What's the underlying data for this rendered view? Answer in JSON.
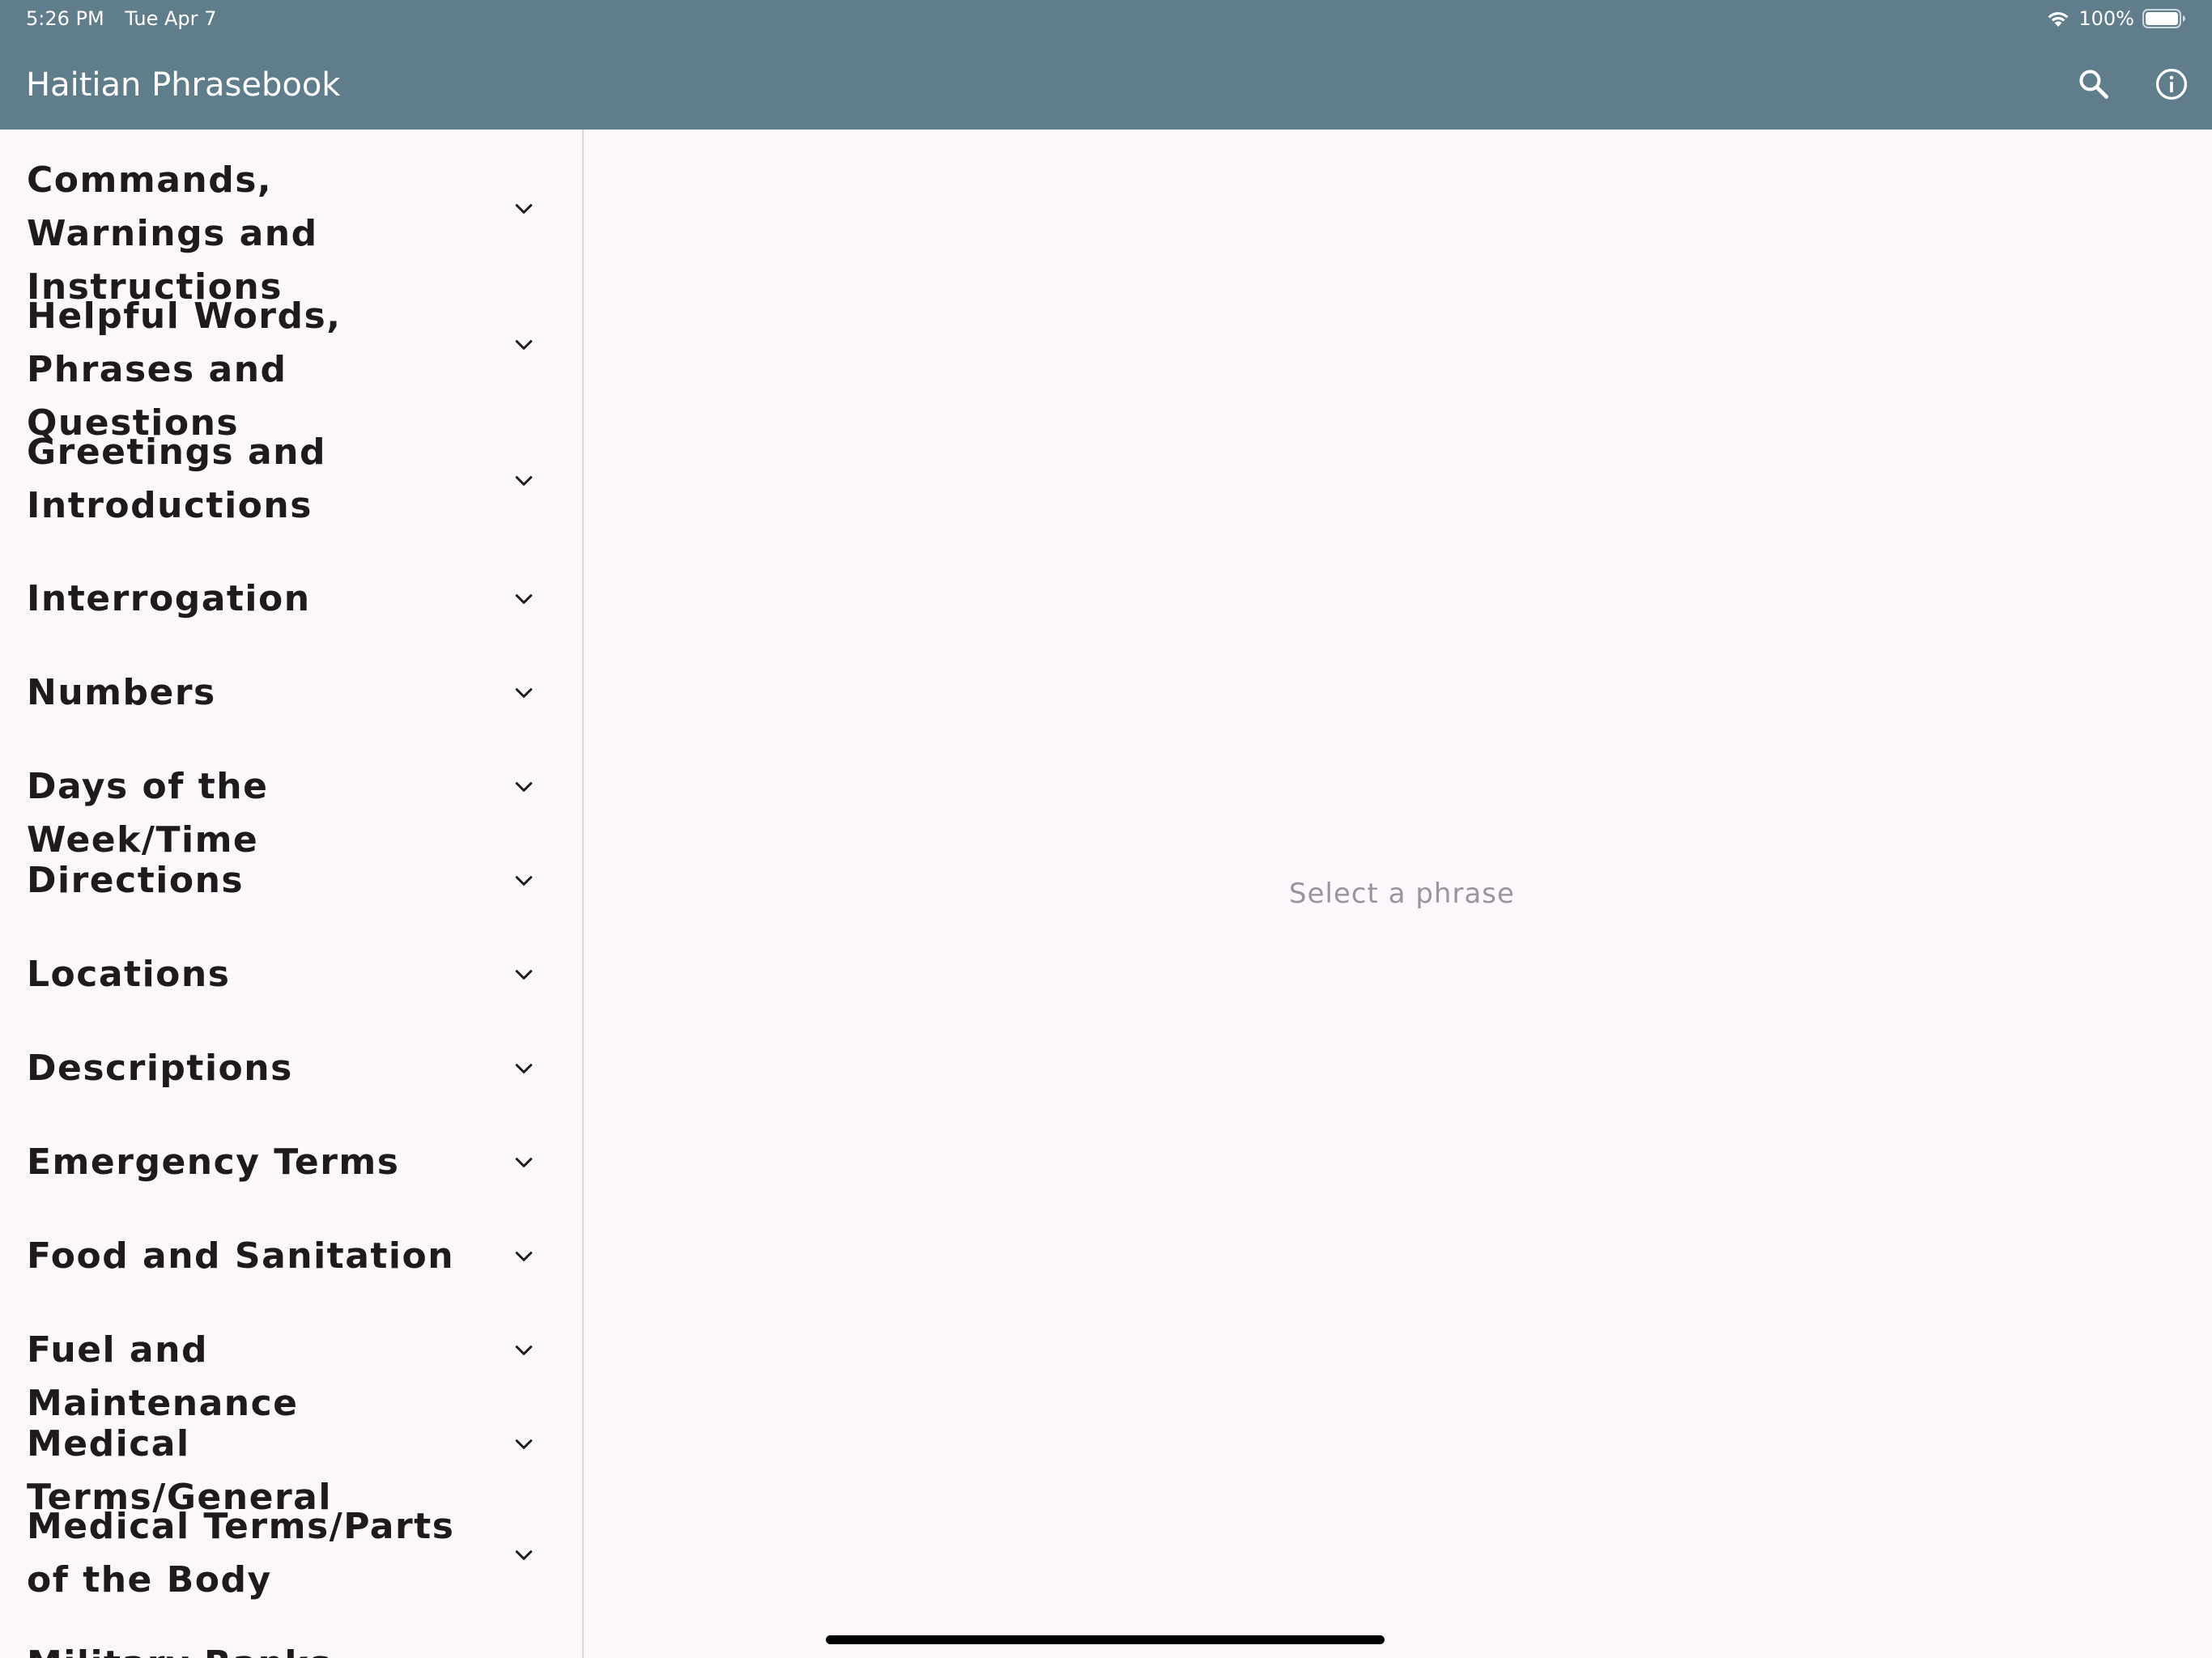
{
  "status_bar": {
    "time": "5:26 PM",
    "date": "Tue Apr 7",
    "battery": "100%"
  },
  "app_bar": {
    "title": "Haitian Phrasebook",
    "icons": [
      "search-icon",
      "info-icon"
    ]
  },
  "sidebar": {
    "items": [
      {
        "label": "Commands, Warnings and Instructions"
      },
      {
        "label": "Helpful Words, Phrases and Questions"
      },
      {
        "label": "Greetings and Introductions"
      },
      {
        "label": "Interrogation"
      },
      {
        "label": "Numbers"
      },
      {
        "label": "Days of the Week/Time"
      },
      {
        "label": "Directions"
      },
      {
        "label": "Locations"
      },
      {
        "label": "Descriptions"
      },
      {
        "label": "Emergency Terms"
      },
      {
        "label": "Food and Sanitation"
      },
      {
        "label": "Fuel and Maintenance"
      },
      {
        "label": "Medical Terms/General"
      },
      {
        "label": "Medical Terms/Parts of the Body"
      },
      {
        "label": "Military Ranks"
      }
    ]
  },
  "detail": {
    "placeholder": "Select a phrase"
  },
  "colors": {
    "app_bar": "#607d8b",
    "background": "#fdf7fc",
    "text": "#1d1b1e",
    "placeholder": "#9a959c"
  }
}
